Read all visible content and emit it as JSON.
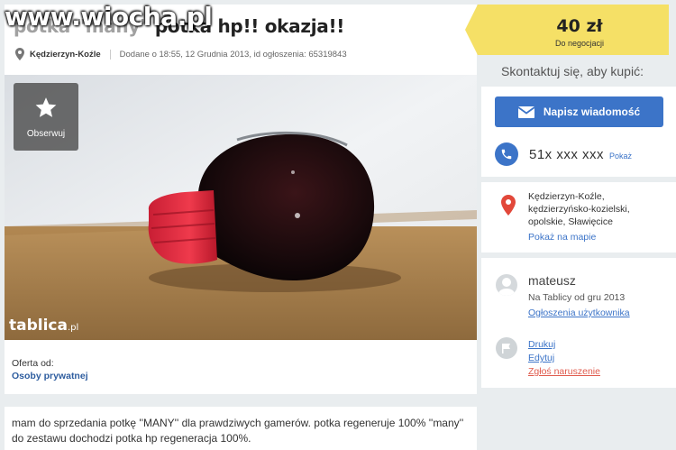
{
  "watermark": "www.wiocha.pl",
  "listing": {
    "title_blur": "potka \"many\"",
    "title_main": "potka hp!! okazja!!",
    "location": "Kędzierzyn-Koźle",
    "meta": "Dodane o 18:55, 12 Grudnia 2013, id ogłoszenia: 65319843",
    "observe_label": "Obserwuj",
    "brand": "tablica",
    "brand_suffix": ".pl",
    "offer_from_label": "Oferta od:",
    "offer_from_value": "Osoby prywatnej",
    "description": "mam do sprzedania potkę ''MANY'' dla prawdziwych gamerów. potka regeneruje 100% ''many'' do zestawu dochodzi potka hp regeneracja 100%."
  },
  "price": {
    "amount": "40 zł",
    "note": "Do negocjacji",
    "tag_color": "#f5e066"
  },
  "contact": {
    "heading": "Skontaktuj się, aby kupić:",
    "message_button": "Napisz wiadomość",
    "phone": "51x xxx xxx",
    "phone_show": "Pokaż"
  },
  "address": {
    "line1": "Kędzierzyn-Koźle,",
    "line2": "kędzierzyńsko-kozielski,",
    "line3": "opolskie, Sławięcice",
    "map_link": "Pokaż na mapie"
  },
  "user": {
    "name": "mateusz",
    "since": "Na Tablicy od gru 2013",
    "ads_link": "Ogłoszenia użytkownika"
  },
  "actions": {
    "print": "Drukuj",
    "edit": "Edytuj",
    "report": "Zgłoś naruszenie"
  },
  "colors": {
    "accent": "#3c74c8",
    "report": "#e05a4c",
    "background": "#e9edef"
  }
}
